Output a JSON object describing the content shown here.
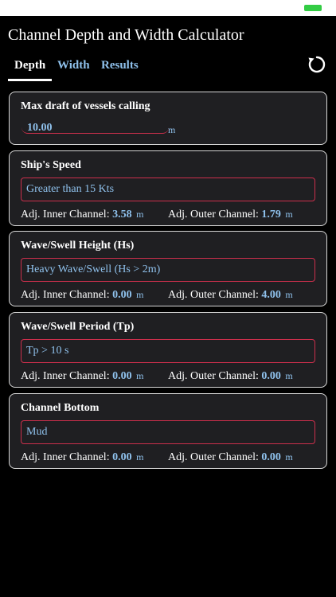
{
  "header": {
    "title": "Channel Depth and Width Calculator"
  },
  "tabs": [
    {
      "label": "Depth",
      "active": true
    },
    {
      "label": "Width",
      "active": false
    },
    {
      "label": "Results",
      "active": false
    }
  ],
  "icons": {
    "refresh": "refresh-icon"
  },
  "colors": {
    "accent": "#8fc1ec",
    "border_active": "#cc2f4c",
    "card_bg": "#1f1f22"
  },
  "draft": {
    "title": "Max draft of vessels calling",
    "value": "10.00",
    "unit": "m"
  },
  "cards": [
    {
      "title": "Ship's Speed",
      "selected": "Greater than 15 Kts",
      "inner_label": "Adj. Inner Channel:",
      "inner_value": "3.58",
      "outer_label": "Adj. Outer Channel:",
      "outer_value": "1.79",
      "unit": "m"
    },
    {
      "title": "Wave/Swell Height (Hs)",
      "selected": "Heavy Wave/Swell (Hs > 2m)",
      "inner_label": "Adj. Inner Channel:",
      "inner_value": "0.00",
      "outer_label": "Adj. Outer Channel:",
      "outer_value": "4.00",
      "unit": "m"
    },
    {
      "title": "Wave/Swell Period (Tp)",
      "selected": "Tp > 10 s",
      "inner_label": "Adj. Inner Channel:",
      "inner_value": "0.00",
      "outer_label": "Adj. Outer Channel:",
      "outer_value": "0.00",
      "unit": "m"
    },
    {
      "title": "Channel Bottom",
      "selected": "Mud",
      "inner_label": "Adj. Inner Channel:",
      "inner_value": "0.00",
      "outer_label": "Adj. Outer Channel:",
      "outer_value": "0.00",
      "unit": "m"
    }
  ]
}
